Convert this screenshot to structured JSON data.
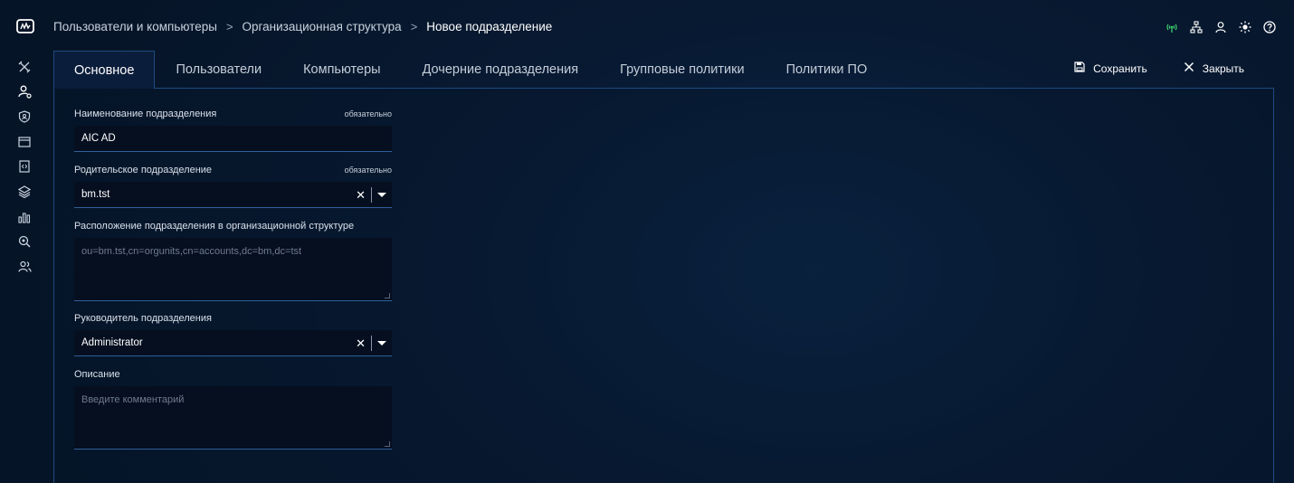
{
  "breadcrumb": {
    "items": [
      "Пользователи и компьютеры",
      "Организационная структура",
      "Новое подразделение"
    ],
    "separator": ">"
  },
  "header_icons": [
    "wifi-icon",
    "network-icon",
    "user-icon",
    "sun-icon",
    "help-icon"
  ],
  "sidebar_icons": [
    "tools-icon",
    "users-settings-icon",
    "shield-icon",
    "window-icon",
    "code-file-icon",
    "layers-icon",
    "bar-chart-icon",
    "zoom-search-icon",
    "group-icon"
  ],
  "tabs": [
    {
      "label": "Основное",
      "active": true
    },
    {
      "label": "Пользователи",
      "active": false
    },
    {
      "label": "Компьютеры",
      "active": false
    },
    {
      "label": "Дочерние подразделения",
      "active": false
    },
    {
      "label": "Групповые политики",
      "active": false
    },
    {
      "label": "Политики ПО",
      "active": false
    }
  ],
  "actions": {
    "save_label": "Сохранить",
    "close_label": "Закрыть"
  },
  "form": {
    "name": {
      "label": "Наименование подразделения",
      "required": "обязательно",
      "value": "AIC AD"
    },
    "parent": {
      "label": "Родительское подразделение",
      "required": "обязательно",
      "value": "bm.tst",
      "clear": "✕"
    },
    "location": {
      "label": "Расположение подразделения в организационной структуре",
      "value": "ou=bm.tst,cn=orgunits,cn=accounts,dc=bm,dc=tst"
    },
    "manager": {
      "label": "Руководитель подразделения",
      "value": "Administrator",
      "clear": "✕"
    },
    "description": {
      "label": "Описание",
      "placeholder": "Введите комментарий"
    }
  },
  "colors": {
    "background": "#061427",
    "accent_border": "#1e4a80",
    "input_bg": "#050f20",
    "status_green": "#3ecf6e"
  }
}
